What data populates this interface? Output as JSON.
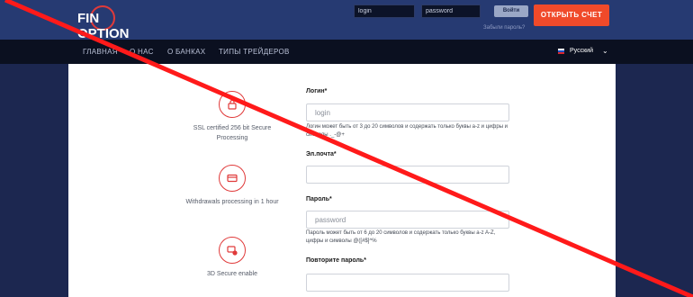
{
  "header": {
    "logo_text": "FIN OPTION",
    "login_placeholder": "login",
    "password_placeholder": "password",
    "signin_label": "Войти",
    "forgot_label": "Забыли пароль?",
    "open_account_label": "ОТКРЫТЬ СЧЕТ"
  },
  "nav": {
    "items": [
      "ГЛАВНАЯ",
      "О НАС",
      "О БАНКАХ",
      "ТИПЫ ТРЕЙДЕРОВ"
    ],
    "language": "Русский"
  },
  "features": [
    {
      "icon": "lock-icon",
      "text": "SSL certified 256 bit Secure Processing"
    },
    {
      "icon": "credit-card-icon",
      "text": "Withdrawals processing in 1 hour"
    },
    {
      "icon": "secure-card-icon",
      "text": "3D Secure enable"
    }
  ],
  "form": {
    "login_label": "Логин*",
    "login_placeholder": "login",
    "login_hint": "Логин может быть от 3 до 20 символов и содержать только буквы a-z и цифры и символы ._-@+",
    "email_label": "Эл.почта*",
    "password_label": "Пароль*",
    "password_placeholder": "password",
    "password_hint": "Пароль может быть от 6 до 20 символов и содержать только буквы a-z A-Z, цифры и символы @([#$]^%",
    "repeat_password_label": "Повторите пароль*"
  },
  "colors": {
    "header_bg": "#263a72",
    "nav_bg": "#0b1020",
    "accent": "#f04a2a",
    "icon_red": "#e03a3a",
    "overlay_line": "#ff1a1a"
  }
}
